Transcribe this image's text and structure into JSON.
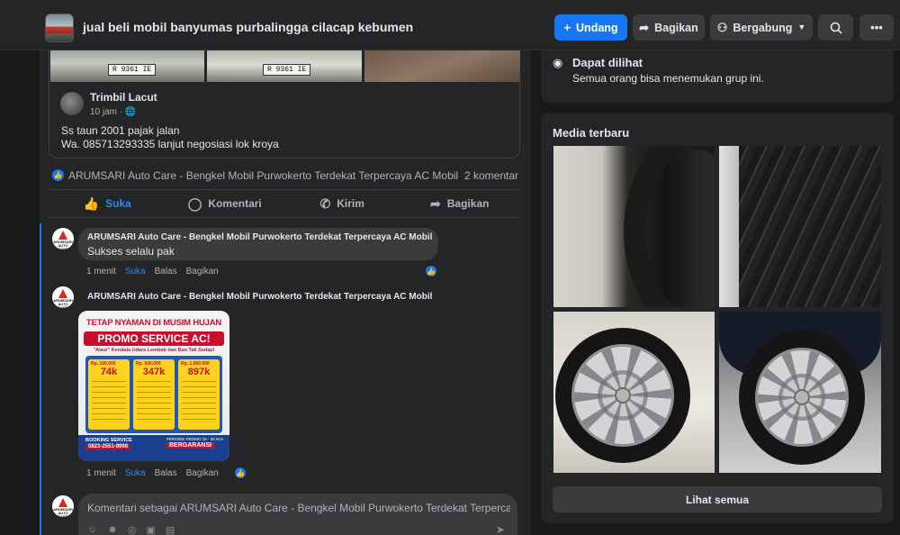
{
  "header": {
    "group_title": "jual beli mobil banyumas purbalingga cilacap kebumen",
    "invite_label": "Undang",
    "share_label": "Bagikan",
    "joined_label": "Bergabung",
    "icons": [
      "plus-icon",
      "share-arrow-icon",
      "group-icon",
      "caret-down-icon",
      "search-icon",
      "more-icon"
    ]
  },
  "shared_post": {
    "plates": [
      "R 9361 IE",
      "R 9361 IE"
    ],
    "author": "Trimbil Lacut",
    "time": "10 jam ·",
    "text_line1": "Ss taun 2001 pajak jalan",
    "text_line2": "Wa. 085713293335 lanjut negosiasi lok kroya"
  },
  "reactions": {
    "who": "ARUMSARI Auto Care - Bengkel Mobil Purwokerto Terdekat Terpercaya AC Mobil",
    "comments_count": "2 komentar"
  },
  "actions": {
    "like": "Suka",
    "comment": "Komentari",
    "send": "Kirim",
    "share": "Bagikan"
  },
  "comments": [
    {
      "author": "ARUMSARI Auto Care - Bengkel Mobil Purwokerto Terdekat Terpercaya AC Mobil",
      "text": "Sukses selalu pak",
      "time": "1 menit",
      "like": "Suka",
      "reply": "Balas",
      "share": "Bagikan"
    },
    {
      "author": "ARUMSARI Auto Care - Bengkel Mobil Purwokerto Terdekat Terpercaya AC Mobil",
      "time": "1 menit",
      "like": "Suka",
      "reply": "Balas",
      "share": "Bagikan",
      "promo": {
        "headline": "TETAP NYAMAN DI MUSIM HUJAN",
        "title": "PROMO SERVICE AC!",
        "tagline": "\"Atasi\" Kendala Udara Lembab dan Bau Tak Sedap!",
        "prices": [
          {
            "old": "Rp. 100.000",
            "value": "74k"
          },
          {
            "old": "Rp. 500.000",
            "value": "347k"
          },
          {
            "old": "Rp. 1.000.000",
            "value": "897k"
          }
        ],
        "booking_label": "BOOKING SERVICE",
        "booking_phone": "0823-2551-9998",
        "period": "PERIODE PROMO 15 - 30 Nov 2024",
        "guarantee": "BERGARANSI"
      }
    }
  ],
  "avatar_text": "ARUMSARI AUTO CARE",
  "composer": {
    "placeholder": "Komentari sebagai ARUMSARI Auto Care - Bengkel Mobil Purwokerto Terdekat Terpercaya AC Mobil",
    "tools": [
      "sticker-icon",
      "emoji-icon",
      "camera-icon",
      "gif-icon",
      "sticker-alt-icon"
    ]
  },
  "sidebar": {
    "visibility_title": "Dapat dilihat",
    "visibility_desc": "Semua orang bisa menemukan grup ini.",
    "media_title": "Media terbaru",
    "see_all": "Lihat semua"
  }
}
